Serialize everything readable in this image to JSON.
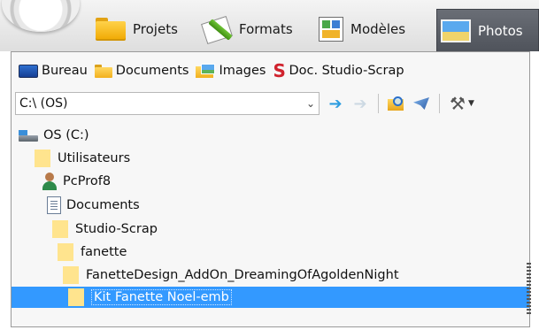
{
  "topbar": {
    "tabs": [
      {
        "label": "Projets",
        "icon": "folder-icon"
      },
      {
        "label": "Formats",
        "icon": "formats-icon"
      },
      {
        "label": "Modèles",
        "icon": "templates-icon"
      },
      {
        "label": "Photos",
        "icon": "photo-icon",
        "active": true
      }
    ],
    "active_tab_color": "#55595f"
  },
  "quick_access": [
    {
      "label": "Bureau",
      "icon": "desktop-icon"
    },
    {
      "label": "Documents",
      "icon": "folder-icon"
    },
    {
      "label": "Images",
      "icon": "images-folder-icon"
    },
    {
      "label": "Doc. Studio-Scrap",
      "icon": "studio-scrap-icon"
    }
  ],
  "path": {
    "value": "C:\\ (OS)"
  },
  "toolbar": {
    "back": "arrow-left-icon",
    "forward": "arrow-right-icon",
    "search_folder": "search-folder-icon",
    "send": "send-icon",
    "settings": "tools-icon"
  },
  "tree": {
    "nodes": [
      {
        "label": "OS (C:)",
        "icon": "drive-icon"
      },
      {
        "label": "Utilisateurs",
        "icon": "folder-icon"
      },
      {
        "label": "PcProf8",
        "icon": "user-icon"
      },
      {
        "label": "Documents",
        "icon": "document-icon"
      },
      {
        "label": "Studio-Scrap",
        "icon": "folder-icon"
      },
      {
        "label": "fanette",
        "icon": "folder-icon"
      },
      {
        "label": "FanetteDesign_AddOn_DreamingOfAgoldenNight",
        "icon": "folder-icon"
      },
      {
        "label": "Kit Fanette Noel-emb",
        "icon": "folder-icon",
        "selected": true
      }
    ],
    "selection_color": "#3399ff"
  }
}
